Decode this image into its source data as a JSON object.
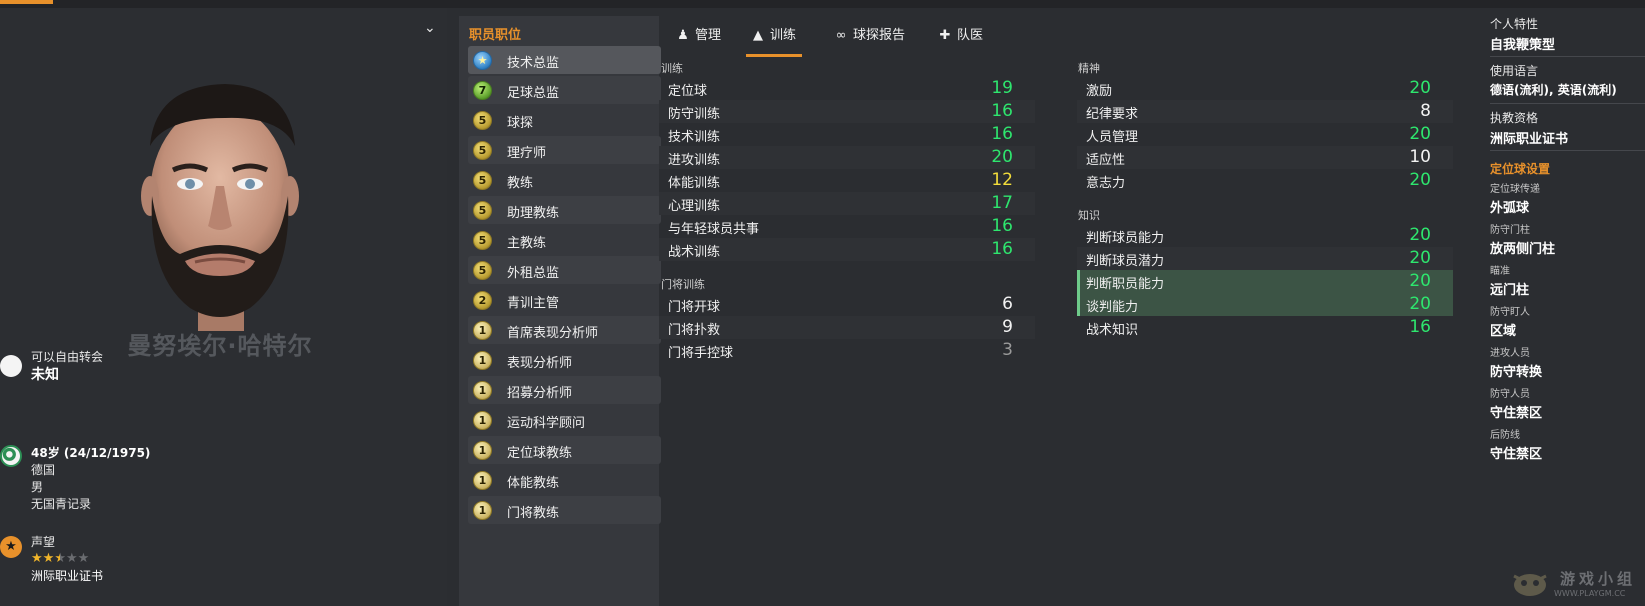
{
  "colors": {
    "accent": "#e8912b",
    "value_green": "#2ee66e",
    "value_yellow": "#f3dd3b",
    "value_white": "#f2f2f2",
    "value_grey": "#9a9a9a"
  },
  "profile": {
    "name": "曼努埃尔·哈特尔",
    "contract": {
      "label": "可以自由转会",
      "value": "未知"
    },
    "personal": {
      "age_dob": "48岁 (24/12/1975)",
      "nationality": "德国",
      "gender": "男",
      "youth": "无国青记录"
    },
    "reputation": {
      "label": "声望",
      "stars": 2.5,
      "max_stars": 5,
      "value": "洲际职业证书"
    }
  },
  "roles": {
    "title": "职员职位",
    "items": [
      {
        "label": "技术总监",
        "badge": "★",
        "style": "blue",
        "selected": true
      },
      {
        "label": "足球总监",
        "badge": "7",
        "style": "green"
      },
      {
        "label": "球探",
        "badge": "5",
        "style": "gold"
      },
      {
        "label": "理疗师",
        "badge": "5",
        "style": "gold"
      },
      {
        "label": "教练",
        "badge": "5",
        "style": "gold"
      },
      {
        "label": "助理教练",
        "badge": "5",
        "style": "gold"
      },
      {
        "label": "主教练",
        "badge": "5",
        "style": "gold"
      },
      {
        "label": "外租总监",
        "badge": "5",
        "style": "gold"
      },
      {
        "label": "青训主管",
        "badge": "2",
        "style": "gold"
      },
      {
        "label": "首席表现分析师",
        "badge": "1",
        "style": "plain"
      },
      {
        "label": "表现分析师",
        "badge": "1",
        "style": "plain"
      },
      {
        "label": "招募分析师",
        "badge": "1",
        "style": "plain"
      },
      {
        "label": "运动科学顾问",
        "badge": "1",
        "style": "plain"
      },
      {
        "label": "定位球教练",
        "badge": "1",
        "style": "plain"
      },
      {
        "label": "体能教练",
        "badge": "1",
        "style": "plain"
      },
      {
        "label": "门将教练",
        "badge": "1",
        "style": "plain"
      }
    ]
  },
  "tabs": [
    {
      "label": "管理",
      "icon": "manager-icon"
    },
    {
      "label": "训练",
      "icon": "training-cone-icon",
      "active": true
    },
    {
      "label": "球探报告",
      "icon": "binoculars-icon"
    },
    {
      "label": "队医",
      "icon": "medical-kit-icon"
    }
  ],
  "attributes": {
    "training": {
      "title": "训练",
      "items": [
        {
          "name": "定位球",
          "value": "19",
          "color": "green"
        },
        {
          "name": "防守训练",
          "value": "16",
          "color": "green"
        },
        {
          "name": "技术训练",
          "value": "16",
          "color": "green"
        },
        {
          "name": "进攻训练",
          "value": "20",
          "color": "green"
        },
        {
          "name": "体能训练",
          "value": "12",
          "color": "yellow"
        },
        {
          "name": "心理训练",
          "value": "17",
          "color": "green"
        },
        {
          "name": "与年轻球员共事",
          "value": "16",
          "color": "green"
        },
        {
          "name": "战术训练",
          "value": "16",
          "color": "green"
        }
      ]
    },
    "goalkeeping": {
      "title": "门将训练",
      "items": [
        {
          "name": "门将开球",
          "value": "6",
          "color": "white"
        },
        {
          "name": "门将扑救",
          "value": "9",
          "color": "white"
        },
        {
          "name": "门将手控球",
          "value": "3",
          "color": "grey"
        }
      ]
    },
    "mental": {
      "title": "精神",
      "items": [
        {
          "name": "激励",
          "value": "20",
          "color": "green"
        },
        {
          "name": "纪律要求",
          "value": "8",
          "color": "white"
        },
        {
          "name": "人员管理",
          "value": "20",
          "color": "green"
        },
        {
          "name": "适应性",
          "value": "10",
          "color": "white"
        },
        {
          "name": "意志力",
          "value": "20",
          "color": "green"
        }
      ]
    },
    "knowledge": {
      "title": "知识",
      "items": [
        {
          "name": "判断球员能力",
          "value": "20",
          "color": "green"
        },
        {
          "name": "判断球员潜力",
          "value": "20",
          "color": "green"
        },
        {
          "name": "判断职员能力",
          "value": "20",
          "color": "green",
          "highlight": true
        },
        {
          "name": "谈判能力",
          "value": "20",
          "color": "green",
          "highlight": true
        },
        {
          "name": "战术知识",
          "value": "16",
          "color": "green"
        }
      ]
    }
  },
  "side": {
    "traits_label": "个人特性",
    "traits_value": "自我鞭策型",
    "language_label": "使用语言",
    "language_value": "德语(流利), 英语(流利)",
    "license_label": "执教资格",
    "license_value": "洲际职业证书",
    "setpiece_title": "定位球设置",
    "setpieces": [
      {
        "label": "定位球传递",
        "value": "外弧球"
      },
      {
        "label": "防守门柱",
        "value": "放两侧门柱"
      },
      {
        "label": "瞄准",
        "value": "远门柱"
      },
      {
        "label": "防守盯人",
        "value": "区域"
      },
      {
        "label": "进攻人员",
        "value": "防守转换"
      },
      {
        "label": "防守人员",
        "value": "守住禁区"
      },
      {
        "label": "后防线",
        "value": "守住禁区"
      }
    ]
  },
  "watermark": {
    "text": "游戏小组",
    "url": "WWW.PLAYGM.CC"
  }
}
